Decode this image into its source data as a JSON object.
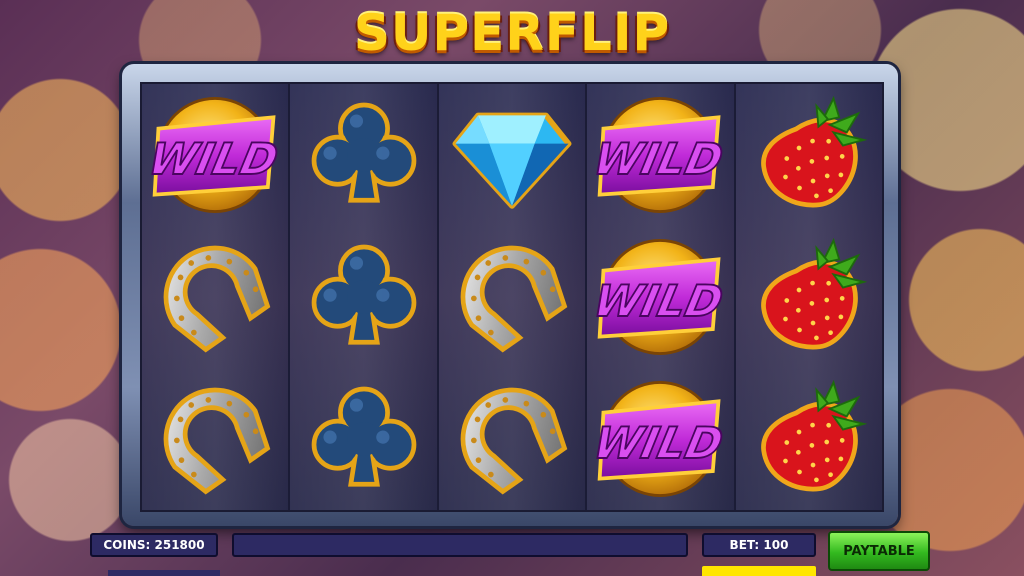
{
  "game": {
    "title": "SUPERFLIP",
    "grid": [
      [
        "wild",
        "horseshoe",
        "horseshoe"
      ],
      [
        "club",
        "club",
        "club"
      ],
      [
        "diamond",
        "horseshoe",
        "horseshoe"
      ],
      [
        "wild",
        "wild",
        "wild"
      ],
      [
        "strawberry",
        "strawberry",
        "strawberry"
      ]
    ],
    "wild_label": "WILD"
  },
  "footer": {
    "coins_label": "COINS: 251800",
    "message": "",
    "bet_label": "BET: 100",
    "paytable_label": "PAYTABLE"
  },
  "colors": {
    "reel_bg": "#2b2c52",
    "wild_purple": "#c02ad8",
    "gold": "#f2b318",
    "paytable_green": "#33b91f"
  }
}
